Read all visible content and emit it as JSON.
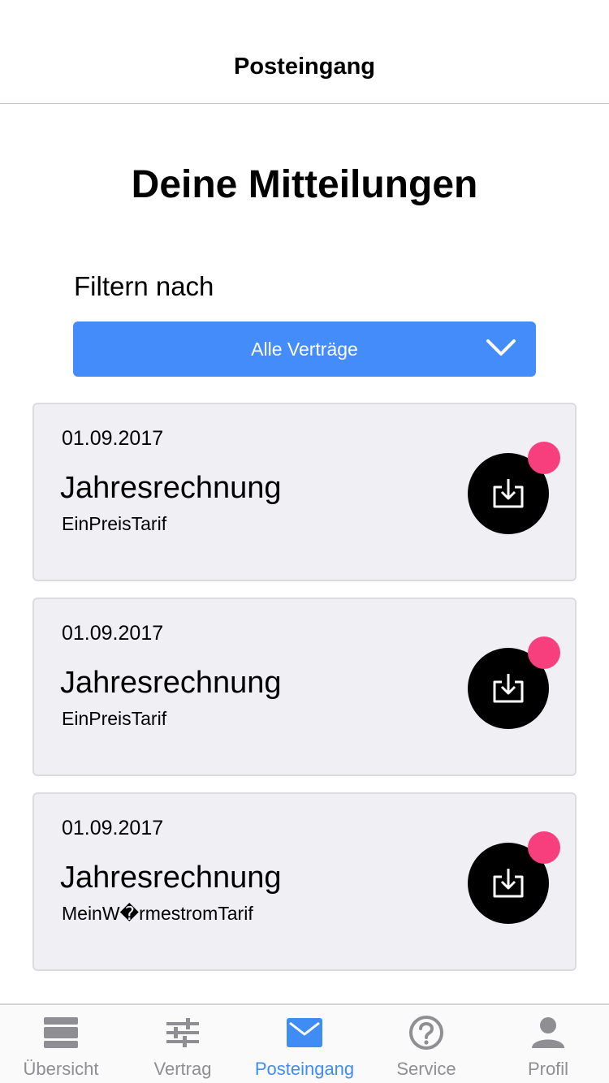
{
  "nav": {
    "title": "Posteingang"
  },
  "heading": "Deine Mitteilungen",
  "filter": {
    "label": "Filtern nach",
    "selected": "Alle Verträge"
  },
  "colors": {
    "accent": "#448cf9",
    "unread": "#f83f7e",
    "tab_inactive": "#8e8e93",
    "tab_active": "#3f8cf5"
  },
  "messages": [
    {
      "date": "01.09.2017",
      "title": "Jahresrechnung",
      "subtitle": "EinPreisTarif",
      "icon": "download-icon",
      "unread": true
    },
    {
      "date": "01.09.2017",
      "title": "Jahresrechnung",
      "subtitle": "EinPreisTarif",
      "icon": "download-icon",
      "unread": true
    },
    {
      "date": "01.09.2017",
      "title": "Jahresrechnung",
      "subtitle": "MeinW�rmestromTarif",
      "icon": "download-icon",
      "unread": true
    }
  ],
  "tabs": [
    {
      "label": "Übersicht",
      "icon": "overview-icon",
      "active": false
    },
    {
      "label": "Vertrag",
      "icon": "sliders-icon",
      "active": false
    },
    {
      "label": "Posteingang",
      "icon": "mail-icon",
      "active": true
    },
    {
      "label": "Service",
      "icon": "help-icon",
      "active": false
    },
    {
      "label": "Profil",
      "icon": "person-icon",
      "active": false
    }
  ]
}
